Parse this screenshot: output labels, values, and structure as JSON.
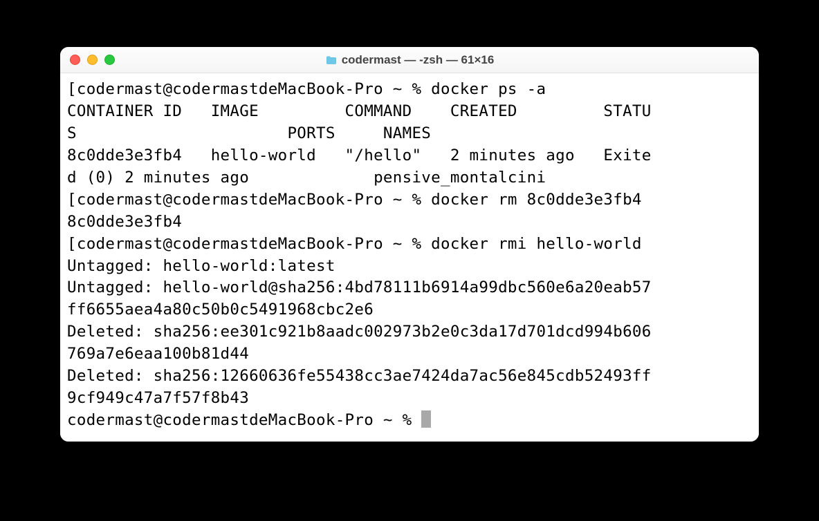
{
  "window": {
    "title": "codermast — -zsh — 61×16"
  },
  "colors": {
    "tl_red": "#ff5f57",
    "tl_yellow": "#ffbd2e",
    "tl_green": "#28c940"
  },
  "prompt": {
    "user": "codermast",
    "host": "codermastdeMacBook-Pro",
    "cwd": "~",
    "symbol": "%"
  },
  "terminal": {
    "lines": [
      "[codermast@codermastdeMacBook-Pro ~ % docker ps -a",
      "CONTAINER ID   IMAGE         COMMAND    CREATED         STATU",
      "S                      PORTS     NAMES",
      "8c0dde3e3fb4   hello-world   \"/hello\"   2 minutes ago   Exite",
      "d (0) 2 minutes ago             pensive_montalcini",
      "[codermast@codermastdeMacBook-Pro ~ % docker rm 8c0dde3e3fb4",
      "8c0dde3e3fb4",
      "[codermast@codermastdeMacBook-Pro ~ % docker rmi hello-world",
      "Untagged: hello-world:latest",
      "Untagged: hello-world@sha256:4bd78111b6914a99dbc560e6a20eab57",
      "ff6655aea4a80c50b0c5491968cbc2e6",
      "Deleted: sha256:ee301c921b8aadc002973b2e0c3da17d701dcd994b606",
      "769a7e6eaa100b81d44",
      "Deleted: sha256:12660636fe55438cc3ae7424da7ac56e845cdb52493ff",
      "9cf949c47a7f57f8b43",
      "codermast@codermastdeMacBook-Pro ~ % "
    ]
  },
  "commands": [
    "docker ps -a",
    "docker rm 8c0dde3e3fb4",
    "docker rmi hello-world"
  ],
  "docker_ps": {
    "headers": [
      "CONTAINER ID",
      "IMAGE",
      "COMMAND",
      "CREATED",
      "STATUS",
      "PORTS",
      "NAMES"
    ],
    "rows": [
      {
        "container_id": "8c0dde3e3fb4",
        "image": "hello-world",
        "command": "\"/hello\"",
        "created": "2 minutes ago",
        "status": "Exited (0) 2 minutes ago",
        "ports": "",
        "names": "pensive_montalcini"
      }
    ]
  },
  "docker_rm_output": "8c0dde3e3fb4",
  "docker_rmi_output": [
    "Untagged: hello-world:latest",
    "Untagged: hello-world@sha256:4bd78111b6914a99dbc560e6a20eab57ff6655aea4a80c50b0c5491968cbc2e6",
    "Deleted: sha256:ee301c921b8aadc002973b2e0c3da17d701dcd994b606769a7e6eaa100b81d44",
    "Deleted: sha256:12660636fe55438cc3ae7424da7ac56e845cdb52493ff9cf949c47a7f57f8b43"
  ]
}
